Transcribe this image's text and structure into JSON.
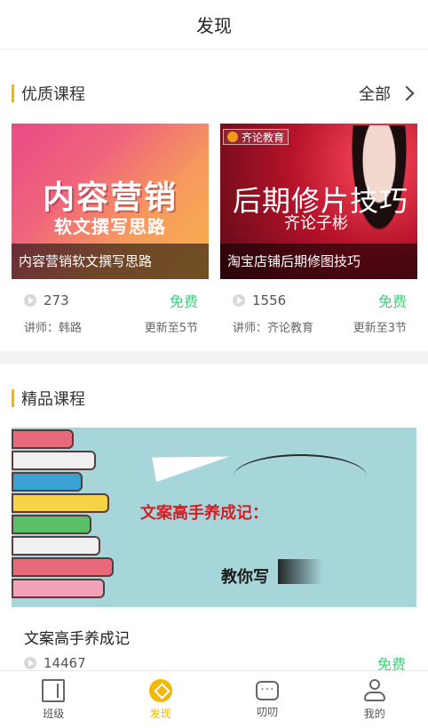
{
  "header": {
    "title": "发现"
  },
  "quality": {
    "label": "优质课程",
    "more": "全部",
    "courses": [
      {
        "thumb_title": "内容营销",
        "thumb_subtitle": "软文撰写思路",
        "caption": "内容营销软文撰写思路",
        "plays": "273",
        "price": "免费",
        "teacher": "讲师：韩路",
        "update": "更新至5节"
      },
      {
        "thumb_brand": "齐论教育",
        "thumb_title": "后期修片技巧",
        "thumb_subtitle": "齐论子彬",
        "caption": "淘宝店铺后期修图技巧",
        "plays": "1556",
        "price": "免费",
        "teacher": "讲师：齐论教育",
        "update": "更新至3节"
      }
    ]
  },
  "premium": {
    "label": "精品课程",
    "banner_line1": "文案高手养成记：",
    "banner_line2": "教你写",
    "course_title": "文案高手养成记",
    "plays": "14467",
    "price": "免费"
  },
  "tabbar": {
    "items": [
      {
        "label": "班级",
        "icon": "class-icon"
      },
      {
        "label": "发现",
        "icon": "discover-icon",
        "active": true
      },
      {
        "label": "叨叨",
        "icon": "chat-icon"
      },
      {
        "label": "我的",
        "icon": "profile-icon"
      }
    ]
  },
  "colors": {
    "accent": "#f5b800",
    "free": "#3ccf7a"
  }
}
